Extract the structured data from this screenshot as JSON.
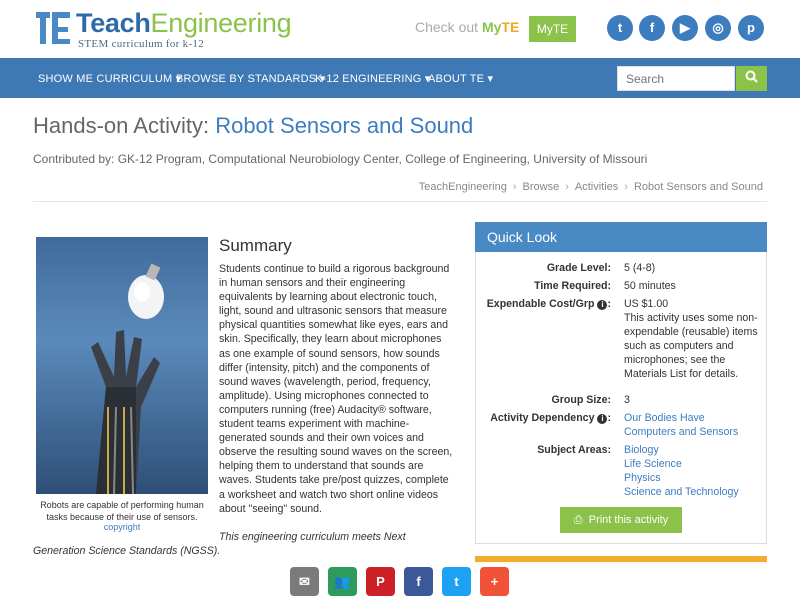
{
  "header": {
    "logo_title_part1": "Teach",
    "logo_title_part2": "Engineering",
    "logo_subtitle": "STEM curriculum for k-12",
    "checkout_prefix": "Check out",
    "checkout_my": "My",
    "checkout_te": "TE",
    "myte_button": "MyTE",
    "social": [
      {
        "name": "twitter-icon",
        "glyph": "t",
        "color": "#3d7dbf"
      },
      {
        "name": "facebook-icon",
        "glyph": "f",
        "color": "#3d7dbf"
      },
      {
        "name": "youtube-icon",
        "glyph": "▶",
        "color": "#3d7dbf"
      },
      {
        "name": "instagram-icon",
        "glyph": "◎",
        "color": "#3d7dbf"
      },
      {
        "name": "pinterest-icon",
        "glyph": "p",
        "color": "#3d7dbf"
      }
    ]
  },
  "nav": {
    "items": [
      "SHOW ME CURRICULUM",
      "BROWSE BY STANDARDS",
      "K-12 ENGINEERING",
      "ABOUT TE"
    ],
    "search_placeholder": "Search",
    "search_icon": "search-icon"
  },
  "page": {
    "title_prefix": "Hands-on Activity:",
    "title_name": "Robot Sensors and Sound",
    "contributed": "Contributed by: GK-12 Program, Computational Neurobiology Center, College of Engineering, University of Missouri",
    "breadcrumb": [
      "TeachEngineering",
      "Browse",
      "Activities",
      "Robot Sensors and Sound"
    ]
  },
  "image": {
    "caption": "Robots are capable of performing human tasks because of their use of sensors.",
    "copyright": "copyright"
  },
  "summary": {
    "heading": "Summary",
    "text": "Students continue to build a rigorous background in human sensors and their engineering equivalents by learning about electronic touch, light, sound and ultrasonic sensors that measure physical quantities somewhat like eyes, ears and skin. Specifically, they learn about microphones as one example of sound sensors, how sounds differ (intensity, pitch) and the components of sound waves (wavelength, period, frequency, amplitude). Using microphones connected to computers running (free) Audacity® software, student teams experiment with machine-generated sounds and their own voices and observe the resulting sound waves on the screen, helping them to understand that sounds are waves. Students take pre/post quizzes, complete a worksheet and watch two short online videos about \"seeing\" sound.",
    "ngss_line1": "This engineering curriculum meets Next",
    "ngss_line2": "Generation Science Standards (NGSS)."
  },
  "quick_look": {
    "heading": "Quick Look",
    "grade_label": "Grade Level:",
    "grade_value": "5 (4-8)",
    "time_label": "Time Required:",
    "time_value": "50 minutes",
    "cost_label": "Expendable Cost/Grp",
    "cost_value": "US $1.00",
    "cost_note": "This activity uses some non-expendable (reusable) items such as computers and microphones; see the Materials List for details.",
    "group_label": "Group Size:",
    "group_value": "3",
    "dependency_label": "Activity Dependency",
    "dependency_links": [
      "Our Bodies Have",
      "Computers and Sensors"
    ],
    "subject_label": "Subject Areas:",
    "subjects": [
      "Biology",
      "Life Science",
      "Physics",
      "Science and Technology"
    ],
    "print_button": "Print this activity",
    "info_glyph": "i"
  },
  "sharebar": {
    "buttons": [
      {
        "name": "email-share-icon",
        "glyph": "✉",
        "color": "#7a7a7a"
      },
      {
        "name": "classroom-share-icon",
        "glyph": "👥",
        "color": "#2e9a5c"
      },
      {
        "name": "pinterest-share-icon",
        "glyph": "P",
        "color": "#cc2127"
      },
      {
        "name": "facebook-share-icon",
        "glyph": "f",
        "color": "#3b5998"
      },
      {
        "name": "twitter-share-icon",
        "glyph": "t",
        "color": "#1da1f2"
      },
      {
        "name": "more-share-icon",
        "glyph": "+",
        "color": "#f0533a"
      }
    ]
  }
}
